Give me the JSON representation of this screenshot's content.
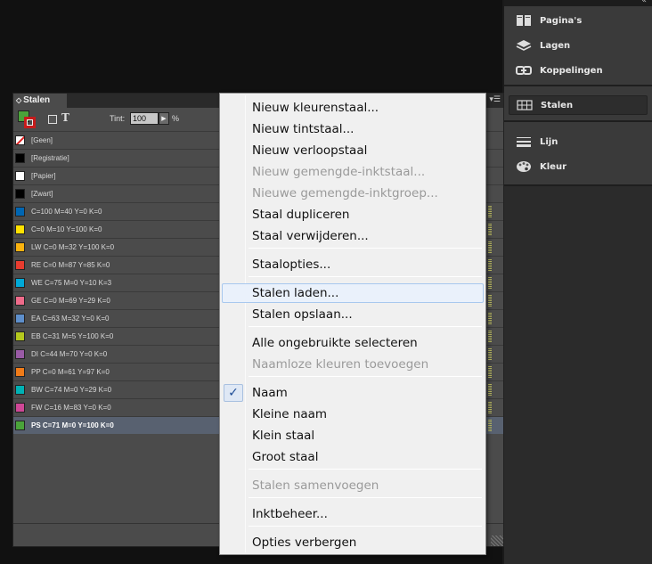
{
  "panel": {
    "tab_label": "Stalen",
    "tab_glyph": "◇",
    "tint_label": "Tint:",
    "tint_value": "100",
    "tint_unit": "%",
    "type_glyph": "T",
    "swatches": [
      {
        "label": "[Geen]",
        "color": "none"
      },
      {
        "label": "[Registratie]",
        "color": "#000000"
      },
      {
        "label": "[Papier]",
        "color": "#ffffff"
      },
      {
        "label": "[Zwart]",
        "color": "#000000"
      },
      {
        "label": "C=100 M=40 Y=0 K=0",
        "color": "#0066b3"
      },
      {
        "label": "C=0 M=10 Y=100 K=0",
        "color": "#ffe100"
      },
      {
        "label": "LW C=0 M=32 Y=100 K=0",
        "color": "#f9b20f"
      },
      {
        "label": "RE C=0 M=87 Y=85 K=0",
        "color": "#e73c2f"
      },
      {
        "label": "WE C=75 M=0 Y=10 K=3",
        "color": "#00a9d8"
      },
      {
        "label": "GE C=0 M=69 Y=29 K=0",
        "color": "#ef6b8a"
      },
      {
        "label": "EA C=63 M=32 Y=0 K=0",
        "color": "#5e8fcb"
      },
      {
        "label": "EB C=31 M=5 Y=100 K=0",
        "color": "#b5c81e"
      },
      {
        "label": "DI C=44 M=70 Y=0 K=0",
        "color": "#9a5ba6"
      },
      {
        "label": "PP C=0 M=61 Y=97 K=0",
        "color": "#f07b18"
      },
      {
        "label": "BW C=74 M=0 Y=29 K=0",
        "color": "#00b1b4"
      },
      {
        "label": "FW C=16 M=83 Y=0 K=0",
        "color": "#cf4796"
      },
      {
        "label": "PS C=71 M=0 Y=100 K=0",
        "color": "#4aa33a",
        "selected": true
      }
    ]
  },
  "dock": {
    "items": [
      {
        "label": "Pagina's",
        "icon": "pages-icon"
      },
      {
        "label": "Lagen",
        "icon": "layers-icon"
      },
      {
        "label": "Koppelingen",
        "icon": "links-icon"
      },
      {
        "label": "Stalen",
        "icon": "swatches-grid-icon",
        "active": true
      },
      {
        "label": "Lijn",
        "icon": "stroke-icon"
      },
      {
        "label": "Kleur",
        "icon": "color-palette-icon"
      }
    ],
    "collapse_glyph": "«"
  },
  "context_menu": {
    "items": [
      {
        "label": "Nieuw kleurenstaal...",
        "disabled": false
      },
      {
        "label": "Nieuw tintstaal...",
        "disabled": false
      },
      {
        "label": "Nieuw verloopstaal",
        "disabled": false
      },
      {
        "label": "Nieuw gemengde-inktstaal...",
        "disabled": true
      },
      {
        "label": "Nieuwe gemengde-inktgroep...",
        "disabled": true
      },
      {
        "label": "Staal dupliceren",
        "disabled": false
      },
      {
        "label": "Staal verwijderen...",
        "disabled": false
      },
      {
        "label": "Staalopties...",
        "disabled": false
      },
      {
        "label": "Stalen laden...",
        "disabled": false,
        "hover": true
      },
      {
        "label": "Stalen opslaan...",
        "disabled": false
      },
      {
        "label": "Alle ongebruikte selecteren",
        "disabled": false
      },
      {
        "label": "Naamloze kleuren toevoegen",
        "disabled": true
      },
      {
        "label": "Naam",
        "disabled": false,
        "checked": true
      },
      {
        "label": "Kleine naam",
        "disabled": false
      },
      {
        "label": "Klein staal",
        "disabled": false
      },
      {
        "label": "Groot staal",
        "disabled": false
      },
      {
        "label": "Stalen samenvoegen",
        "disabled": true
      },
      {
        "label": "Inktbeheer...",
        "disabled": false
      },
      {
        "label": "Opties verbergen",
        "disabled": false
      }
    ],
    "check_glyph": "✓"
  }
}
